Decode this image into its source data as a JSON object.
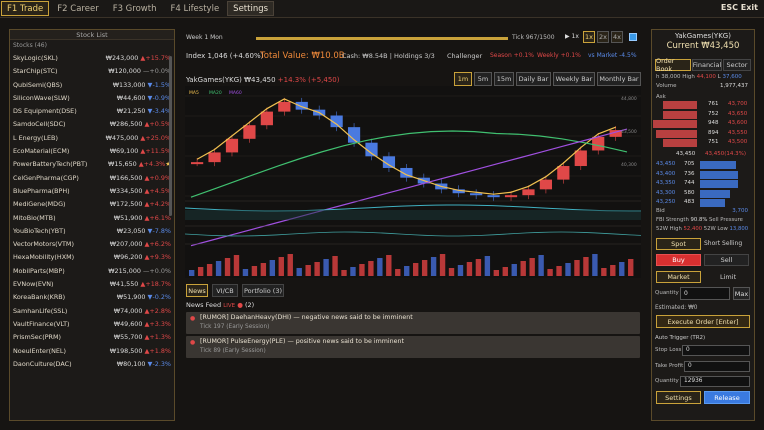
{
  "topbar": {
    "tabs": [
      "F1  Trade",
      "F2  Career",
      "F3  Growth",
      "F4  Lifestyle",
      "Settings"
    ],
    "exit": "ESC  Exit"
  },
  "stock_list": {
    "title": "Stock List",
    "count_label": "Stocks (46)",
    "items": [
      {
        "name": "SkyLogic(SKL)",
        "price": "₩243,000",
        "chg": "▲+15.7%",
        "dir": "up"
      },
      {
        "name": "StarChip(STC)",
        "price": "₩120,000",
        "chg": "—+0.0%",
        "dir": "fl"
      },
      {
        "name": "QubiSemi(QBS)",
        "price": "₩133,000",
        "chg": "▼-1.5%",
        "dir": "dn"
      },
      {
        "name": "SiliconWave(SLW)",
        "price": "₩44,600",
        "chg": "▼-0.9%",
        "dir": "dn"
      },
      {
        "name": "DS Equipment(DSE)",
        "price": "₩21,250",
        "chg": "▼-3.4%",
        "dir": "dn"
      },
      {
        "name": "SamdoCell(SDC)",
        "price": "₩286,500",
        "chg": "▲+0.5%",
        "dir": "up"
      },
      {
        "name": "L Energy(LEB)",
        "price": "₩475,000",
        "chg": "▲+25.0%",
        "dir": "up"
      },
      {
        "name": "EcoMaterial(ECM)",
        "price": "₩69,100",
        "chg": "▲+11.5%",
        "dir": "up"
      },
      {
        "name": "PowerBatteryTech(PBT)",
        "price": "₩15,650",
        "chg": "▲+4.3%",
        "dir": "up",
        "star": true
      },
      {
        "name": "CelGenPharma(CGP)",
        "price": "₩166,500",
        "chg": "▲+0.9%",
        "dir": "up"
      },
      {
        "name": "BluePharma(BPH)",
        "price": "₩334,500",
        "chg": "▲+4.5%",
        "dir": "up"
      },
      {
        "name": "MediGene(MDG)",
        "price": "₩172,500",
        "chg": "▲+4.2%",
        "dir": "up"
      },
      {
        "name": "MitoBio(MTB)",
        "price": "₩51,900",
        "chg": "▲+6.1%",
        "dir": "up"
      },
      {
        "name": "YouBioTech(YBT)",
        "price": "₩23,050",
        "chg": "▼-7.8%",
        "dir": "dn"
      },
      {
        "name": "VectorMotors(VTM)",
        "price": "₩207,000",
        "chg": "▲+6.2%",
        "dir": "up"
      },
      {
        "name": "HexaMobility(HXM)",
        "price": "₩96,200",
        "chg": "▲+9.3%",
        "dir": "up"
      },
      {
        "name": "MobilParts(MBP)",
        "price": "₩215,000",
        "chg": "—+0.0%",
        "dir": "fl"
      },
      {
        "name": "EVNow(EVN)",
        "price": "₩41,550",
        "chg": "▲+18.7%",
        "dir": "up"
      },
      {
        "name": "KoreaBank(KRB)",
        "price": "₩51,900",
        "chg": "▼-0.2%",
        "dir": "dn"
      },
      {
        "name": "SamhanLife(SSL)",
        "price": "₩74,000",
        "chg": "▲+2.8%",
        "dir": "up"
      },
      {
        "name": "VaultFinance(VLT)",
        "price": "₩49,600",
        "chg": "▲+3.3%",
        "dir": "up"
      },
      {
        "name": "PrismSec(PRM)",
        "price": "₩55,700",
        "chg": "▲+1.3%",
        "dir": "up"
      },
      {
        "name": "NoeulEnter(NEL)",
        "price": "₩198,500",
        "chg": "▲+1.8%",
        "dir": "up"
      },
      {
        "name": "DaonCulture(DAC)",
        "price": "₩80,100",
        "chg": "▼-2.3%",
        "dir": "dn"
      }
    ]
  },
  "header": {
    "week": "Week 1 Mon",
    "tick": "Tick 967/1500",
    "speed_play": "▶ 1x",
    "speeds": [
      "1x",
      "2x",
      "4x"
    ],
    "index": "Index 1,046 (+4.60%)",
    "total": "Total Value: ₩10.0B",
    "cash": "Cash: ₩8.54B | Holdings 3/3",
    "challenger": "Challenger",
    "season": "Season +0.1%",
    "weekly": "Weekly +0.1%",
    "vsmarket": "vs Market -4.5%"
  },
  "chart_header": {
    "stock": "YakGames(YKG)",
    "price": "₩43,450",
    "chg": "+14.3% (+5,450)",
    "intervals": [
      "1m",
      "5m",
      "15m",
      "Daily Bar",
      "Weekly Bar",
      "Monthly Bar"
    ],
    "ma": [
      "MA5",
      "MA20",
      "MA60"
    ]
  },
  "chart_data": {
    "type": "candlestick",
    "series_colors": {
      "ma5": "#f0c050",
      "ma20": "#40c070",
      "ma60": "#a050e0"
    },
    "y_ticks": [
      "44,800",
      "43,500",
      "40,300"
    ],
    "price_path": [
      41800,
      42300,
      43000,
      43700,
      44400,
      44900,
      44500,
      44200,
      43600,
      42800,
      42100,
      41500,
      41000,
      40700,
      40400,
      40200,
      40100,
      40000,
      40100,
      40400,
      40900,
      41600,
      42400,
      43100,
      43450
    ],
    "volume_bars": 25
  },
  "news": {
    "tabs": [
      "News",
      "VI/CB",
      "Portfolio (3)"
    ],
    "feed_title": "News Feed",
    "live": "LIVE",
    "count": "(2)",
    "items": [
      {
        "text": "[RUMOR] DaehanHeavy(DHI) — negative news said to be imminent",
        "tick": "Tick 197 (Early Session)"
      },
      {
        "text": "[RUMOR] PulseEnergy(PLE) — positive news said to be imminent",
        "tick": "Tick 89 (Early Session)"
      }
    ]
  },
  "right": {
    "name": "YakGames(YKG)",
    "current": "Current ₩43,450",
    "tabs": [
      "Order Book",
      "Financial",
      "Sector"
    ],
    "hi_label": "h",
    "hi_val": "38,000",
    "high": "High",
    "high_val": "44,100",
    "low": "L",
    "low_val": "37,600",
    "vol_label": "Volume",
    "vol_val": "1,977,437",
    "ask_label": "Ask",
    "asks": [
      {
        "q": "761",
        "p": "43,700"
      },
      {
        "q": "752",
        "p": "43,650"
      },
      {
        "q": "948",
        "p": "43,600"
      },
      {
        "q": "894",
        "p": "43,550"
      },
      {
        "q": "751",
        "p": "43,500"
      }
    ],
    "mid_price": "43,450",
    "mid_chg": "43,450(14.3%)",
    "bids": [
      {
        "p": "43,450",
        "q": "705"
      },
      {
        "p": "43,400",
        "q": "736"
      },
      {
        "p": "43,350",
        "q": "744"
      },
      {
        "p": "43,300",
        "q": "580"
      },
      {
        "p": "43,250",
        "q": "483"
      }
    ],
    "bid_label": "Bid",
    "bid_total": "3,700",
    "fbi": "FBI Strength",
    "fbi_val": "90.8%",
    "fbi_sell": "Sell Pressure",
    "w52h": "52W High",
    "w52h_val": "52,400",
    "w52l": "52W Low",
    "w52l_val": "13,800",
    "spot": "Spot",
    "short": "Short Selling",
    "buy": "Buy",
    "sell": "Sell",
    "market": "Market",
    "limit": "Limit",
    "qty_label": "Quantity",
    "qty_val": "0",
    "max": "Max",
    "est": "Estimated: ₩0",
    "exec": "Execute Order [Enter]",
    "auto": "Auto Trigger (TR2)",
    "stop": "Stop Loss",
    "stop_val": "0",
    "take": "Take Profit",
    "take_val": "0",
    "qty2": "Quantity",
    "qty2_val": "12936",
    "settings": "Settings",
    "release": "Release"
  }
}
